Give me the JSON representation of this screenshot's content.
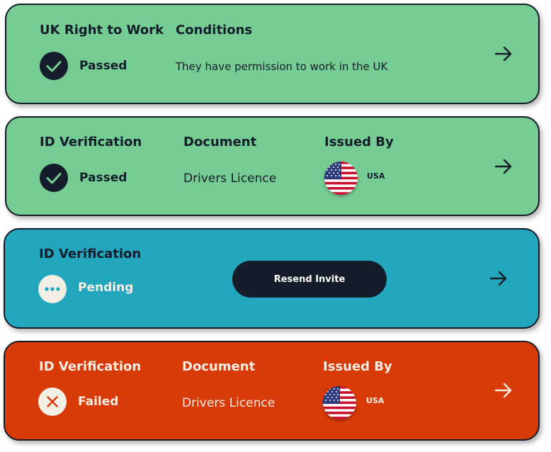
{
  "cards": [
    {
      "title": "UK Right to Work",
      "status": "Passed",
      "conditions_header": "Conditions",
      "conditions_text": "They have permission to work in the UK",
      "status_icon": "check-icon",
      "bg_color": "#76cd93"
    },
    {
      "title": "ID Verification",
      "status": "Passed",
      "document_header": "Document",
      "document_value": "Drivers Licence",
      "issued_header": "Issued By",
      "issued_country": "USA",
      "status_icon": "check-icon",
      "bg_color": "#76cd93"
    },
    {
      "title": "ID Verification",
      "status": "Pending",
      "action_label": "Resend Invite",
      "status_icon": "ellipsis-icon",
      "bg_color": "#21a6bd"
    },
    {
      "title": "ID Verification",
      "status": "Failed",
      "document_header": "Document",
      "document_value": "Drivers Licence",
      "issued_header": "Issued By",
      "issued_country": "USA",
      "status_icon": "x-icon",
      "bg_color": "#d83a08"
    }
  ]
}
